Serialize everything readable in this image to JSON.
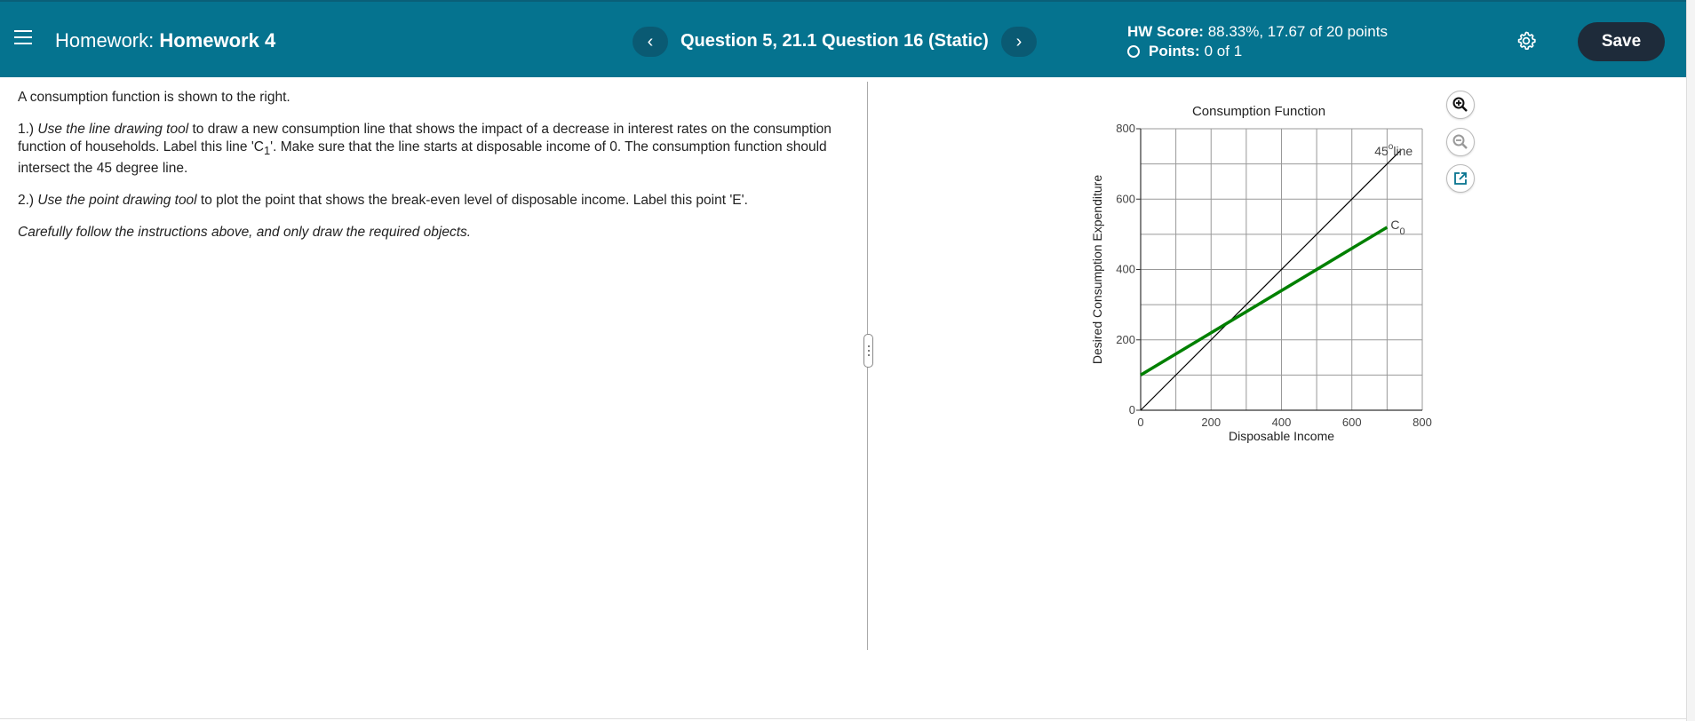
{
  "header": {
    "homework_prefix": "Homework:",
    "homework_name": "Homework 4",
    "prev_label": "‹",
    "next_label": "›",
    "question_title": "Question 5, 21.1 Question 16 (Static)",
    "score_label": "HW Score:",
    "score_value": "88.33%, 17.67 of 20 points",
    "points_label": "Points:",
    "points_value": "0 of 1",
    "save_label": "Save"
  },
  "question": {
    "intro": "A consumption function is shown to the right.",
    "item1_num": "1.) ",
    "item1_em": "Use the line drawing tool",
    "item1_text": " to draw a new consumption line that shows the impact of a decrease in interest rates on the consumption function of households. Label this line 'C",
    "item1_sub": "1",
    "item1_tail": "'. Make sure that the line starts at disposable income of 0. The consumption function should intersect the 45 degree line.",
    "item2_num": "2.) ",
    "item2_em": "Use the point drawing tool",
    "item2_text": " to plot the point that shows the break-even level of disposable income. Label this point 'E'.",
    "note": "Carefully follow the instructions above, and only draw the required objects."
  },
  "icons": {
    "menu": "menu-icon",
    "settings": "gear-icon",
    "zoom_in": "zoom-in-icon",
    "zoom_out": "zoom-out-icon",
    "popout": "external-link-icon"
  },
  "colors": {
    "header_bg": "#05738f",
    "consumption_line": "#008000",
    "save_bg": "#1e2b3a"
  },
  "chart_data": {
    "type": "line",
    "title": "Consumption Function",
    "xlabel": "Disposable Income",
    "ylabel": "Desired Consumption Expenditure",
    "xlim": [
      0,
      800
    ],
    "ylim": [
      0,
      800
    ],
    "xticks": [
      0,
      200,
      400,
      600,
      800
    ],
    "yticks": [
      0,
      200,
      400,
      600,
      800
    ],
    "grid": true,
    "grid_step": 100,
    "series": [
      {
        "name": "45°line",
        "label_main": "45",
        "label_sup": "o",
        "label_tail": "line",
        "color": "#000000",
        "x": [
          0,
          740
        ],
        "y": [
          0,
          740
        ]
      },
      {
        "name": "C0",
        "label_main": "C",
        "label_sub": "0",
        "color": "#008000",
        "x": [
          0,
          700
        ],
        "y": [
          100,
          520
        ]
      }
    ]
  }
}
